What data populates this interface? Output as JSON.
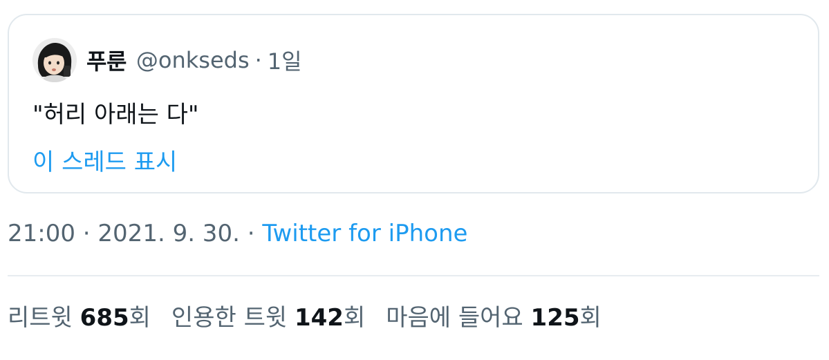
{
  "quoted_tweet": {
    "author_name": "푸룬",
    "author_handle": "@onkseds",
    "separator": "·",
    "age": "1일",
    "text": "\"허리 아래는 다\"",
    "thread_link": "이 스레드 표시",
    "avatar_icon": "profile-avatar"
  },
  "tweet_meta": {
    "time": "21:00",
    "sep1": "·",
    "date": "2021. 9. 30.",
    "sep2": "·",
    "source": "Twitter for iPhone"
  },
  "stats": {
    "retweets_label": "리트윗",
    "retweets_count": "685",
    "retweets_unit": "회",
    "quotes_label": "인용한 트윗",
    "quotes_count": "142",
    "quotes_unit": "회",
    "likes_label": "마음에 들어요",
    "likes_count": "125",
    "likes_unit": "회"
  },
  "colors": {
    "link": "#1d9bf0",
    "secondary_text": "#536471",
    "primary_text": "#0f1419",
    "border": "#e1e8ed"
  }
}
